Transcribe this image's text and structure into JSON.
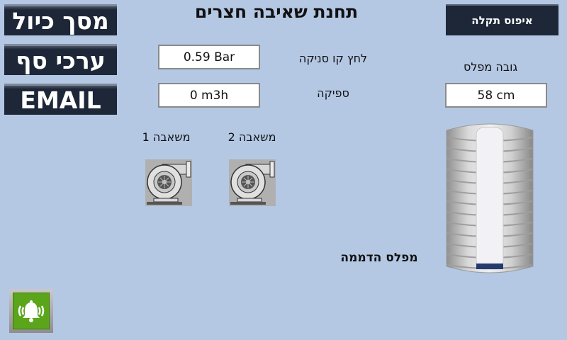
{
  "nav": {
    "calibration_label": "מסך כיול",
    "thresholds_label": "ערכי סף",
    "email_label": "EMAIL"
  },
  "header": {
    "title": "תחנת שאיבה חצרים",
    "reset_fault_label": "איפוס תקלה"
  },
  "readings": {
    "suction_pressure_label": "לחץ קו סניקה",
    "suction_pressure_value": "0.59 Bar",
    "flow_label": "ספיקה",
    "flow_value": "0 m3h",
    "level_label": "גובה מפלס",
    "level_value": "58 cm"
  },
  "pumps": [
    {
      "label": "משאבה 1"
    },
    {
      "label": "משאבה 2"
    }
  ],
  "tank": {
    "label": "מפלס הדממה",
    "fill_fraction": 0.04,
    "fill_color": "#253b6e"
  },
  "colors": {
    "background": "#b4c8e4",
    "button": "#1d2738",
    "alarm_green": "#5aa51a"
  },
  "icons": {
    "alarm": "bell-alarm-icon",
    "pump": "centrifugal-pump-icon"
  }
}
